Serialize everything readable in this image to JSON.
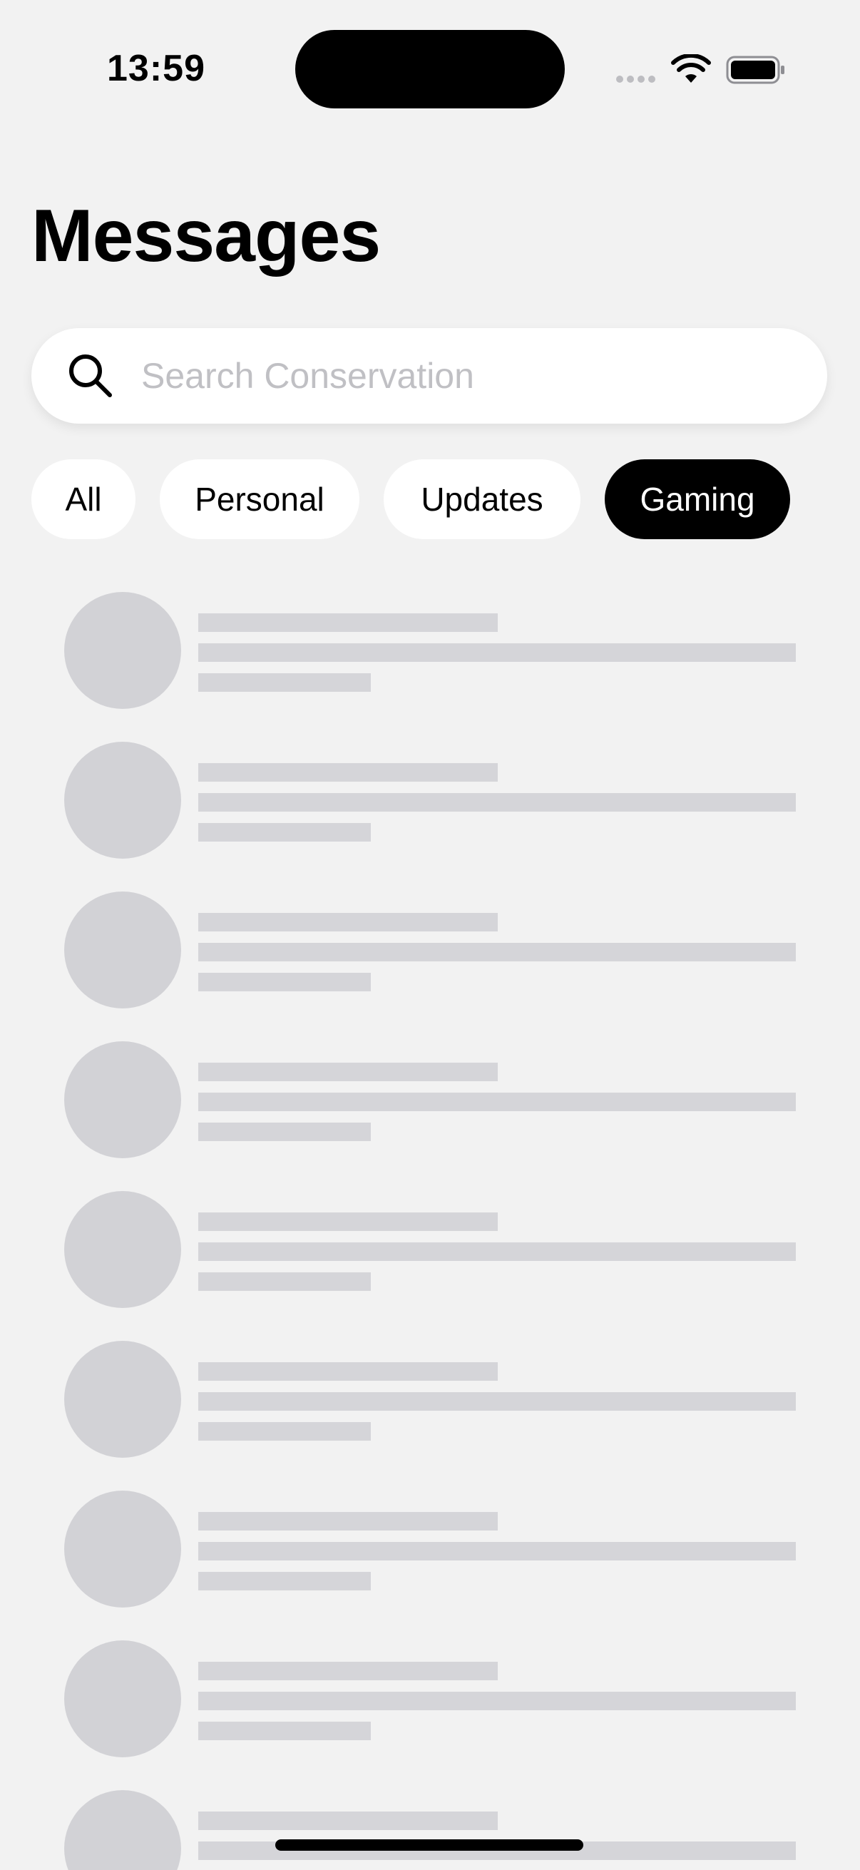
{
  "status_bar": {
    "time": "13:59",
    "icons": [
      "cellular-signal-icon",
      "wifi-icon",
      "battery-icon"
    ]
  },
  "header": {
    "title": "Messages"
  },
  "search": {
    "placeholder": "Search Conservation",
    "value": "",
    "icon": "search-icon"
  },
  "filters": {
    "selected": "Gaming",
    "items": [
      {
        "label": "All"
      },
      {
        "label": "Personal"
      },
      {
        "label": "Updates"
      },
      {
        "label": "Gaming"
      }
    ]
  },
  "conversation_list": {
    "state": "loading",
    "placeholder_rows": 9
  },
  "colors": {
    "background": "#f2f2f2",
    "chip_default": "#ffffff",
    "chip_active": "#000000",
    "skeleton": "#d3d3d7",
    "placeholder_text": "#c0c0c4"
  }
}
